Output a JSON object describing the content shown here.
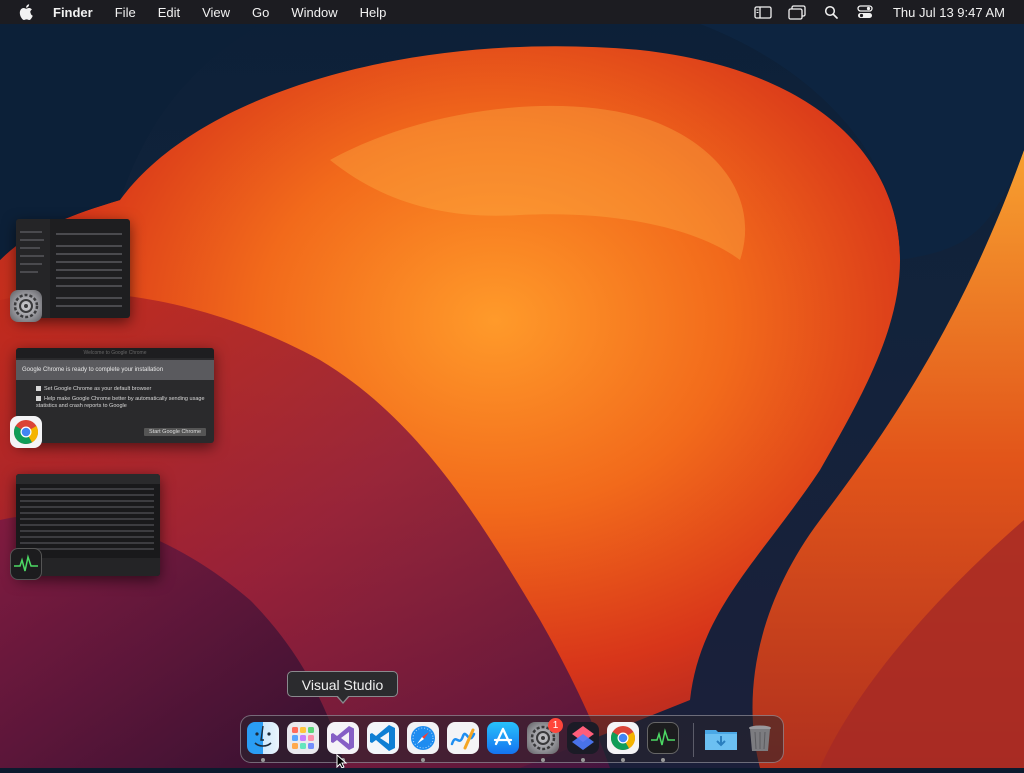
{
  "menubar": {
    "app_name": "Finder",
    "menus": [
      "File",
      "Edit",
      "View",
      "Go",
      "Window",
      "Help"
    ],
    "clock": "Thu Jul 13  9:47 AM",
    "status_icons": [
      "sidebar-icon",
      "stage-manager-icon",
      "spotlight-search-icon",
      "control-center-icon"
    ]
  },
  "stage_manager": {
    "chrome_window": {
      "title": "Welcome to Google Chrome",
      "banner": "Google Chrome is ready to complete your installation",
      "option_1": "Set Google Chrome as your default browser",
      "option_2": "Help make Google Chrome better by automatically sending usage statistics and crash reports to Google",
      "button": "Start Google Chrome"
    }
  },
  "tooltip": {
    "text": "Visual Studio"
  },
  "dock": {
    "items": [
      {
        "name": "Finder",
        "running": true
      },
      {
        "name": "Launchpad",
        "running": false
      },
      {
        "name": "Visual Studio",
        "running": true
      },
      {
        "name": "Visual Studio Code",
        "running": false
      },
      {
        "name": "Safari",
        "running": true
      },
      {
        "name": "Freeform",
        "running": false
      },
      {
        "name": "App Store",
        "running": false
      },
      {
        "name": "System Settings",
        "running": true,
        "badge": "1"
      },
      {
        "name": "Shortcuts",
        "running": true
      },
      {
        "name": "Google Chrome",
        "running": true
      },
      {
        "name": "Activity Monitor",
        "running": true
      },
      {
        "name": "Downloads",
        "running": false
      },
      {
        "name": "Trash",
        "running": false
      }
    ]
  },
  "colors": {
    "menubar": "#1e1c20",
    "badge": "#ff453a",
    "wallpaper_orange": "#f26a1b"
  }
}
